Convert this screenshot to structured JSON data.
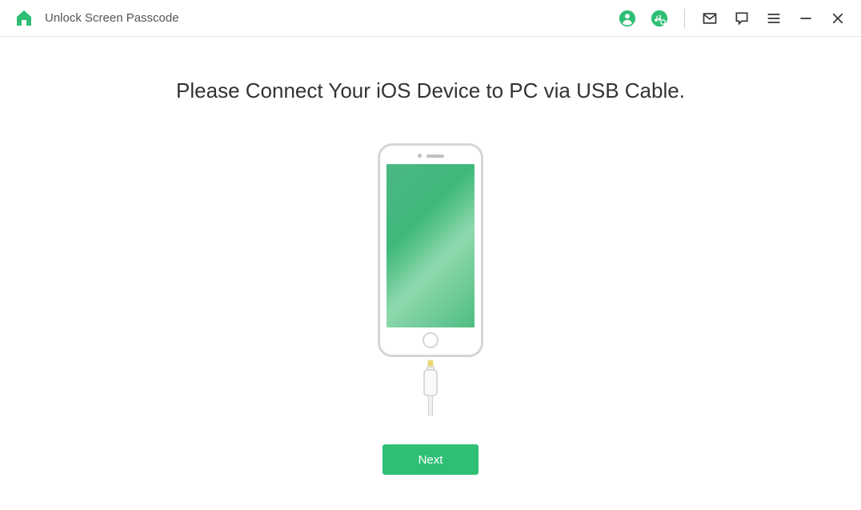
{
  "header": {
    "title": "Unlock Screen Passcode"
  },
  "main": {
    "title": "Please Connect Your iOS Device to PC via USB Cable.",
    "next_label": "Next"
  },
  "colors": {
    "accent": "#2ebf75"
  }
}
